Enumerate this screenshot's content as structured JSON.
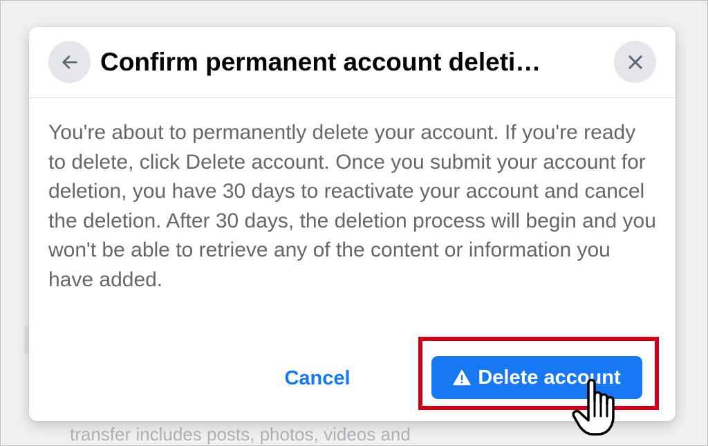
{
  "background": {
    "partial_text": "transfer includes posts, photos, videos and"
  },
  "dialog": {
    "title": "Confirm permanent account deleti…",
    "body": "You're about to permanently delete your account. If you're ready to delete, click Delete account. Once you submit your account for deletion, you have 30 days to reactivate your account and cancel the deletion. After 30 days, the deletion process will begin and you won't be able to retrieve any of the content or information you have added.",
    "cancel_label": "Cancel",
    "delete_label": "Delete account",
    "icons": {
      "back": "arrow-left-icon",
      "close": "close-icon",
      "warning": "warning-triangle-icon",
      "cursor": "hand-pointer-icon"
    }
  },
  "colors": {
    "accent": "#1877f2",
    "highlight": "#d0021b",
    "title": "#050505",
    "body_text": "#65676b",
    "icon_button_bg": "#e4e6eb"
  }
}
